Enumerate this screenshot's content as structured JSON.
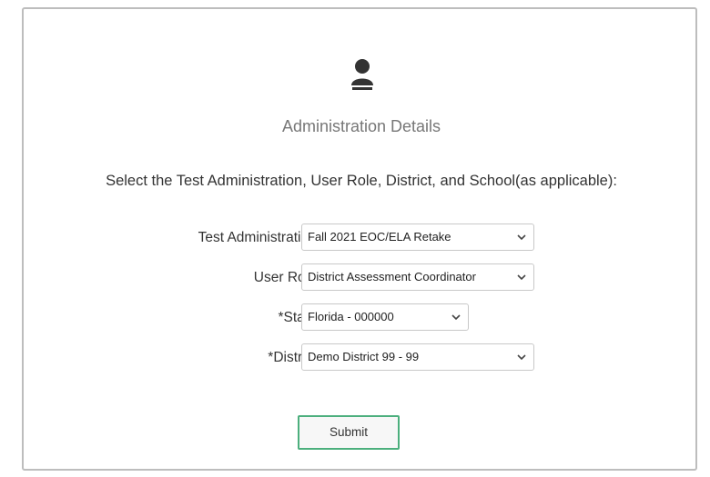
{
  "header": {
    "icon": "user-icon",
    "title": "Administration Details"
  },
  "instructions": "Select the Test Administration, User Role, District, and School(as applicable):",
  "fields": {
    "test_administration": {
      "label": "Test Administration:",
      "value": "Fall 2021 EOC/ELA Retake"
    },
    "user_role": {
      "label": "User Role:",
      "value": "District Assessment Coordinator"
    },
    "state": {
      "label": "*State:",
      "value": "Florida - 000000"
    },
    "district": {
      "label": "*District:",
      "value": "Demo District 99 - 99"
    }
  },
  "submit_label": "Submit",
  "colors": {
    "submit_border": "#4caf7d",
    "panel_border": "#bdbdbd"
  }
}
